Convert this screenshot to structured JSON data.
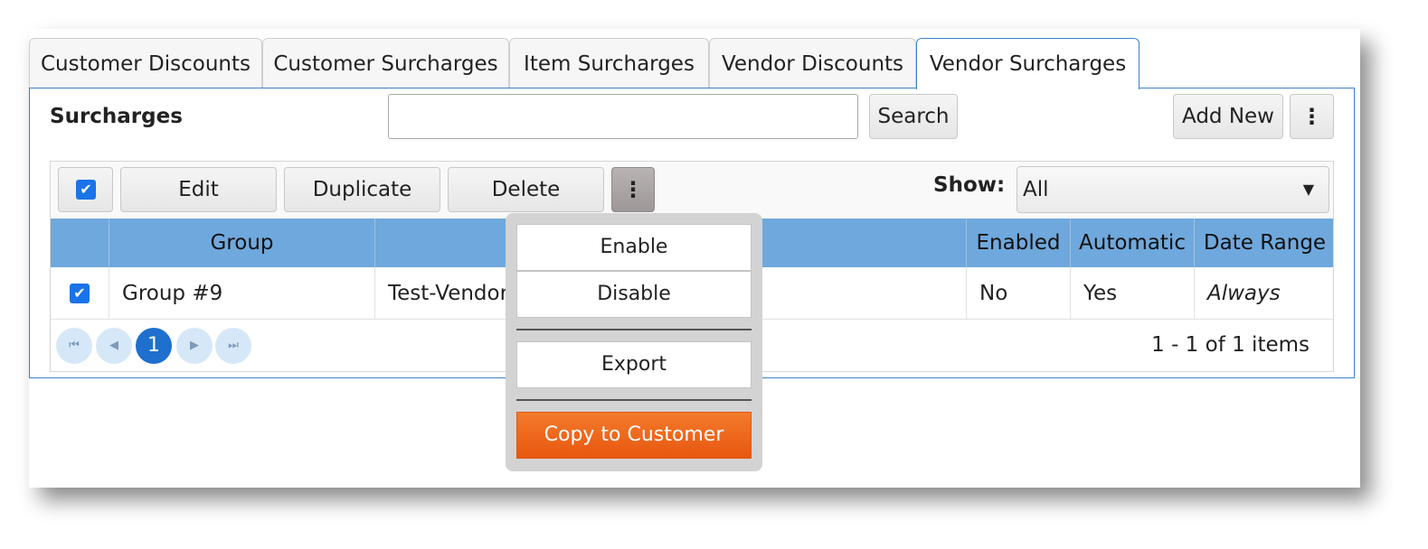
{
  "tabs": [
    {
      "label": "Customer Discounts"
    },
    {
      "label": "Customer Surcharges"
    },
    {
      "label": "Item Surcharges"
    },
    {
      "label": "Vendor Discounts"
    },
    {
      "label": "Vendor Surcharges",
      "active": true
    }
  ],
  "panel": {
    "title": "Surcharges",
    "search": {
      "value": "",
      "placeholder": ""
    },
    "search_button": "Search",
    "add_new_button": "Add New",
    "more_icon": "vertical-ellipsis"
  },
  "toolbar": {
    "select_all_checked": true,
    "edit": "Edit",
    "duplicate": "Duplicate",
    "delete": "Delete",
    "show_label": "Show:",
    "show_value": "All"
  },
  "table": {
    "columns": [
      "Group",
      "",
      "Enabled",
      "Automatic",
      "Date Range"
    ],
    "rows": [
      {
        "checked": true,
        "group": "Group #9",
        "name": "Test-Vendor",
        "enabled": "No",
        "automatic": "Yes",
        "date_range": "Always"
      }
    ]
  },
  "pager": {
    "current_page": "1",
    "info": "1 - 1 of 1 items"
  },
  "menu": {
    "items": [
      "Enable",
      "Disable",
      "Export",
      "Copy to Customer"
    ]
  },
  "colors": {
    "header_blue": "#6fa8dc",
    "accent_blue": "#1a73e8",
    "orange": "#e8570f"
  }
}
